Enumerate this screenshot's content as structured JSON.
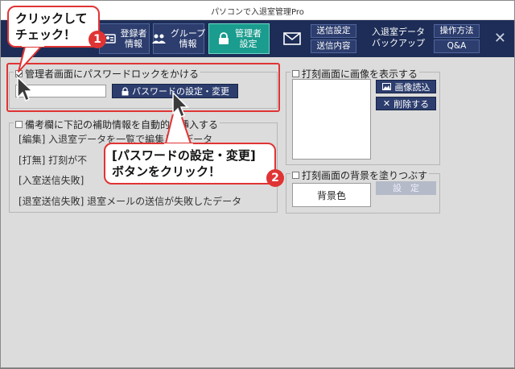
{
  "window": {
    "title": "パソコンで入退室管理Pro"
  },
  "toolbar": {
    "register_info_label": "登録者\n情報",
    "group_info_label": "グループ\n情報",
    "admin_settings_label": "管理者\n設定",
    "send_settings_label": "送信設定",
    "send_content_label": "送信内容",
    "entry_exit_label": "入退室データ",
    "backup_label": "バックアップ",
    "how_to_label": "操作方法",
    "qa_label": "Q&A"
  },
  "password_group": {
    "checkbox_label": "管理者画面にパスワードロックをかける",
    "checked": true,
    "button_label": "パスワードの設定・変更"
  },
  "remarks_group": {
    "legend": "備考欄に下記の補助情報を自動的に挿入する",
    "lines": [
      "[編集]  入退室データを一覧で編集したデータ",
      "[打無]  打刻が不",
      "[入室送信失敗]",
      "[退室送信失敗]  退室メールの送信が失敗したデータ"
    ]
  },
  "image_group": {
    "legend": "打刻画面に画像を表示する",
    "load_button": "画像読込",
    "delete_button": "削除する"
  },
  "bg_group": {
    "legend": "打刻画面の背景を塗りつぶす",
    "color_label": "背景色",
    "settings_button": "設　定"
  },
  "callouts": {
    "step1_text": "クリックして\nチェック！",
    "step1_number": "1",
    "step2_line1": "[パスワードの設定・変更]",
    "step2_line2": "ボタンをクリック！",
    "step2_number": "2"
  },
  "colors": {
    "toolbar_bg": "#1d2d57",
    "active_tab": "#1a9c8e",
    "callout_red": "#e03434"
  }
}
